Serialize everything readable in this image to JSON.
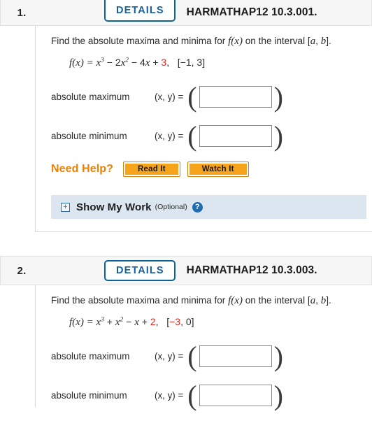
{
  "questions": [
    {
      "number": "1.",
      "details_label": "DETAILS",
      "code": "HARMATHAP12 10.3.001.",
      "prompt_a": "Find the absolute maxima and minima for ",
      "prompt_fx": "f(x)",
      "prompt_b": " on the interval [",
      "prompt_a_var": "a",
      "prompt_comma": ", ",
      "prompt_b_var": "b",
      "prompt_end": "].",
      "formula": {
        "lhs": "f(x) = ",
        "term1_base": "x",
        "term1_exp": "3",
        "op1": " − 2",
        "term2_base": "x",
        "term2_exp": "2",
        "op2": " − 4",
        "term3_base": "x",
        "op3": " + ",
        "constant": "3",
        "constant_red": true,
        "comma": ",",
        "interval": "[−1, 3]",
        "interval_red": false
      },
      "answers": [
        {
          "label": "absolute maximum",
          "xy": "(x, y)  =",
          "value": "",
          "placeholder": ""
        },
        {
          "label": "absolute minimum",
          "xy": "(x, y)  =",
          "value": "",
          "placeholder": ""
        }
      ],
      "need_help": {
        "label": "Need Help?",
        "buttons": [
          "Read It",
          "Watch It"
        ]
      },
      "show_my_work": {
        "plus": "+",
        "title": "Show My Work",
        "optional": "(Optional)",
        "help": "?"
      }
    },
    {
      "number": "2.",
      "details_label": "DETAILS",
      "code": "HARMATHAP12 10.3.003.",
      "prompt_a": "Find the absolute maxima and minima for ",
      "prompt_fx": "f(x)",
      "prompt_b": " on the interval [",
      "prompt_a_var": "a",
      "prompt_comma": ", ",
      "prompt_b_var": "b",
      "prompt_end": "].",
      "formula": {
        "lhs": "f(x) = ",
        "term1_base": "x",
        "term1_exp": "3",
        "op1": " + ",
        "term2_base": "x",
        "term2_exp": "2",
        "op2": " − ",
        "term3_base": "x",
        "op3": " + ",
        "constant": "2",
        "constant_red": true,
        "comma": ",",
        "interval_open": "[",
        "interval_lower": "−3",
        "interval_mid": ", ",
        "interval_upper": "0",
        "interval_close": "]",
        "interval_red": true
      },
      "answers": [
        {
          "label": "absolute maximum",
          "xy": "(x, y)  =",
          "value": "",
          "placeholder": ""
        },
        {
          "label": "absolute minimum",
          "xy": "(x, y)  =",
          "value": "",
          "placeholder": ""
        }
      ]
    }
  ],
  "colors": {
    "details_border": "#0b6398",
    "details_text": "#1560a0",
    "need_help_orange": "#f08000",
    "button_orange": "#f7a41d",
    "red_constant": "#e8261c",
    "show_my_work_bg": "#dbe6f0",
    "header_bg": "#f6f6f6"
  }
}
